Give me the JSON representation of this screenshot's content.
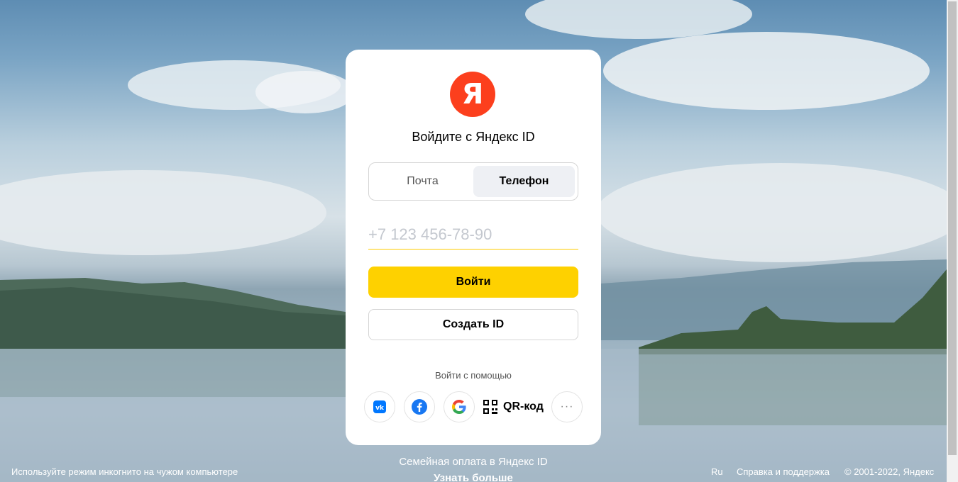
{
  "brand": {
    "logo_letter": "Я",
    "logo_color": "#fc3f1d",
    "accent_color": "#fed100"
  },
  "card": {
    "title": "Войдите с Яндекс ID",
    "tabs": [
      {
        "label": "Почта",
        "active": false
      },
      {
        "label": "Телефон",
        "active": true
      }
    ],
    "phone_input": {
      "value": "",
      "placeholder": "+7 123 456-78-90"
    },
    "login_button": "Войти",
    "create_button": "Создать ID",
    "alt_login_label": "Войти с помощью",
    "socials": [
      {
        "name": "vk-icon"
      },
      {
        "name": "facebook-icon"
      },
      {
        "name": "google-icon"
      }
    ],
    "qr_label": "QR-код",
    "more_label": "···"
  },
  "promo": {
    "text": "Семейная оплата в Яндекс ID",
    "link": "Узнать больше"
  },
  "footer": {
    "incognito_hint": "Используйте режим инкогнито на чужом компьютере",
    "language": "Ru",
    "help": "Справка и поддержка",
    "copyright": "© 2001-2022, Яндекс"
  }
}
